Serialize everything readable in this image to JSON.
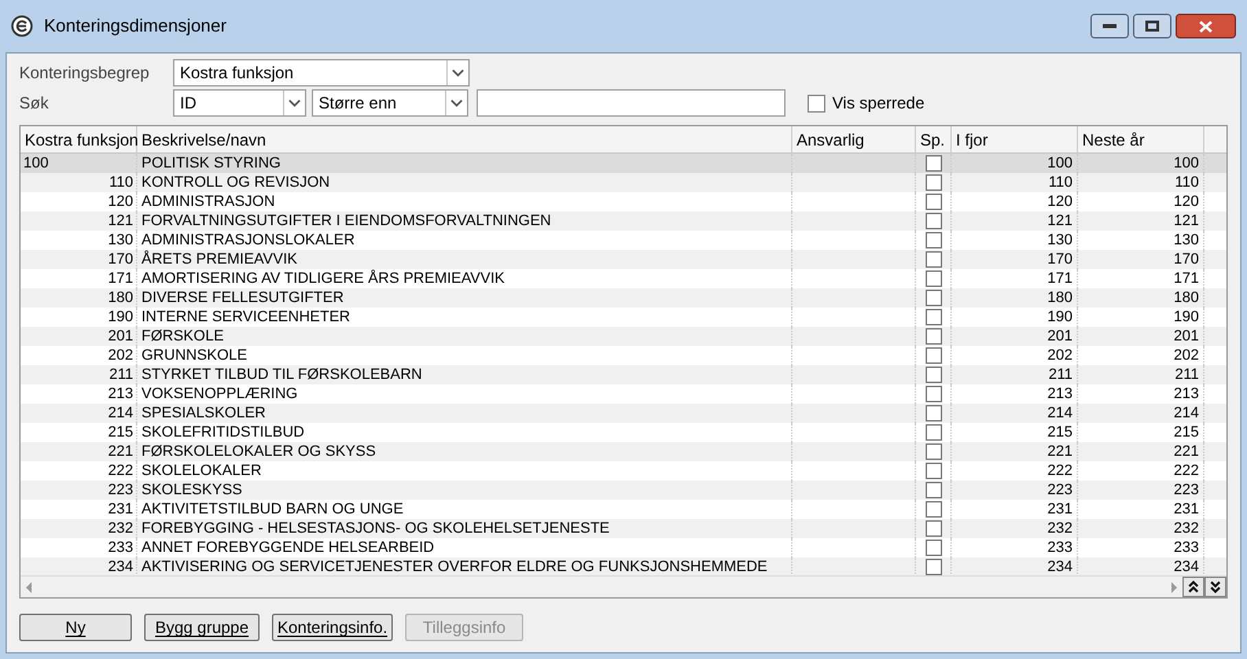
{
  "window": {
    "title": "Konteringsdimensjoner"
  },
  "filters": {
    "konteringsbegrep_label": "Konteringsbegrep",
    "konteringsbegrep_value": "Kostra funksjon",
    "sok_label": "Søk",
    "sok_field": "ID",
    "sok_operator": "Større enn",
    "vis_sperrede": {
      "label": "Vis sperrede",
      "checked": false
    }
  },
  "table": {
    "columns": [
      "Kostra funksjon",
      "Beskrivelse/navn",
      "Ansvarlig",
      "Sp.",
      "I fjor",
      "Neste år"
    ],
    "rows": [
      {
        "code": "100",
        "name": "POLITISK STYRING",
        "sp": false,
        "i_fjor": "100",
        "neste_ar": "100",
        "selected": true
      },
      {
        "code": "110",
        "name": "KONTROLL OG REVISJON",
        "sp": false,
        "i_fjor": "110",
        "neste_ar": "110",
        "selected": false
      },
      {
        "code": "120",
        "name": "ADMINISTRASJON",
        "sp": false,
        "i_fjor": "120",
        "neste_ar": "120",
        "selected": false
      },
      {
        "code": "121",
        "name": "FORVALTNINGSUTGIFTER I EIENDOMSFORVALTNINGEN",
        "sp": false,
        "i_fjor": "121",
        "neste_ar": "121",
        "selected": false
      },
      {
        "code": "130",
        "name": "ADMINISTRASJONSLOKALER",
        "sp": false,
        "i_fjor": "130",
        "neste_ar": "130",
        "selected": false
      },
      {
        "code": "170",
        "name": "ÅRETS PREMIEAVVIK",
        "sp": false,
        "i_fjor": "170",
        "neste_ar": "170",
        "selected": false
      },
      {
        "code": "171",
        "name": "AMORTISERING AV TIDLIGERE ÅRS PREMIEAVVIK",
        "sp": false,
        "i_fjor": "171",
        "neste_ar": "171",
        "selected": false
      },
      {
        "code": "180",
        "name": "DIVERSE FELLESUTGIFTER",
        "sp": false,
        "i_fjor": "180",
        "neste_ar": "180",
        "selected": false
      },
      {
        "code": "190",
        "name": "INTERNE SERVICEENHETER",
        "sp": false,
        "i_fjor": "190",
        "neste_ar": "190",
        "selected": false
      },
      {
        "code": "201",
        "name": "FØRSKOLE",
        "sp": false,
        "i_fjor": "201",
        "neste_ar": "201",
        "selected": false
      },
      {
        "code": "202",
        "name": "GRUNNSKOLE",
        "sp": false,
        "i_fjor": "202",
        "neste_ar": "202",
        "selected": false
      },
      {
        "code": "211",
        "name": "STYRKET TILBUD TIL FØRSKOLEBARN",
        "sp": false,
        "i_fjor": "211",
        "neste_ar": "211",
        "selected": false
      },
      {
        "code": "213",
        "name": "VOKSENOPPLÆRING",
        "sp": false,
        "i_fjor": "213",
        "neste_ar": "213",
        "selected": false
      },
      {
        "code": "214",
        "name": "SPESIALSKOLER",
        "sp": false,
        "i_fjor": "214",
        "neste_ar": "214",
        "selected": false
      },
      {
        "code": "215",
        "name": "SKOLEFRITIDSTILBUD",
        "sp": false,
        "i_fjor": "215",
        "neste_ar": "215",
        "selected": false
      },
      {
        "code": "221",
        "name": "FØRSKOLELOKALER OG SKYSS",
        "sp": false,
        "i_fjor": "221",
        "neste_ar": "221",
        "selected": false
      },
      {
        "code": "222",
        "name": "SKOLELOKALER",
        "sp": false,
        "i_fjor": "222",
        "neste_ar": "222",
        "selected": false
      },
      {
        "code": "223",
        "name": "SKOLESKYSS",
        "sp": false,
        "i_fjor": "223",
        "neste_ar": "223",
        "selected": false
      },
      {
        "code": "231",
        "name": "AKTIVITETSTILBUD BARN OG UNGE",
        "sp": false,
        "i_fjor": "231",
        "neste_ar": "231",
        "selected": false
      },
      {
        "code": "232",
        "name": "FOREBYGGING - HELSESTASJONS- OG SKOLEHELSETJENESTE",
        "sp": false,
        "i_fjor": "232",
        "neste_ar": "232",
        "selected": false
      },
      {
        "code": "233",
        "name": "ANNET FOREBYGGENDE HELSEARBEID",
        "sp": false,
        "i_fjor": "233",
        "neste_ar": "233",
        "selected": false
      },
      {
        "code": "234",
        "name": "AKTIVISERING OG SERVICETJENESTER OVERFOR ELDRE OG FUNKSJONSHEMMEDE",
        "sp": false,
        "i_fjor": "234",
        "neste_ar": "234",
        "selected": false
      }
    ]
  },
  "buttons": [
    {
      "label": "Ny",
      "disabled": false
    },
    {
      "label": "Bygg gruppe",
      "disabled": false
    },
    {
      "label": "Konteringsinfo.",
      "disabled": false
    },
    {
      "label": "Tilleggsinfo",
      "disabled": true
    }
  ]
}
